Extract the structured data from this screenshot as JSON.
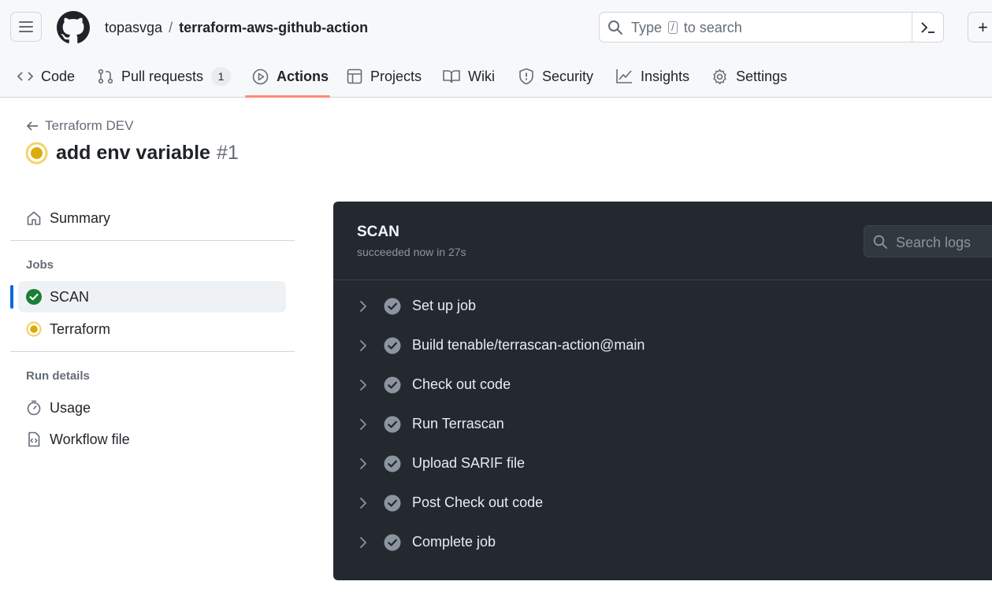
{
  "header": {
    "owner": "topasvga",
    "separator": "/",
    "repo": "terraform-aws-github-action",
    "search_prefix": "Type",
    "search_key": "/",
    "search_suffix": "to search",
    "plus": "+"
  },
  "tabs": [
    {
      "label": "Code",
      "icon": "code-icon"
    },
    {
      "label": "Pull requests",
      "icon": "git-pull-request-icon",
      "counter": "1"
    },
    {
      "label": "Actions",
      "icon": "play-icon",
      "active": true
    },
    {
      "label": "Projects",
      "icon": "table-icon"
    },
    {
      "label": "Wiki",
      "icon": "book-icon"
    },
    {
      "label": "Security",
      "icon": "shield-icon"
    },
    {
      "label": "Insights",
      "icon": "graph-icon"
    },
    {
      "label": "Settings",
      "icon": "gear-icon"
    }
  ],
  "run": {
    "workflow": "Terraform DEV",
    "title": "add env variable",
    "number": "#1",
    "status": "in-progress"
  },
  "sidebar": {
    "summary": "Summary",
    "jobs_heading": "Jobs",
    "jobs": [
      {
        "label": "SCAN",
        "status": "success",
        "selected": true
      },
      {
        "label": "Terraform",
        "status": "in-progress"
      }
    ],
    "details_heading": "Run details",
    "usage": "Usage",
    "workflow_file": "Workflow file"
  },
  "log": {
    "job_name": "SCAN",
    "meta": "succeeded now in 27s",
    "search_placeholder": "Search logs",
    "steps": [
      {
        "label": "Set up job"
      },
      {
        "label": "Build tenable/terrascan-action@main"
      },
      {
        "label": "Check out code"
      },
      {
        "label": "Run Terrascan"
      },
      {
        "label": "Upload SARIF file"
      },
      {
        "label": "Post Check out code"
      },
      {
        "label": "Complete job"
      }
    ]
  },
  "colors": {
    "accent_underline": "#fd8c73",
    "success": "#1a7f37",
    "in_progress": "#dbab0a",
    "selected_bar": "#0969da",
    "log_bg": "#24292f"
  }
}
